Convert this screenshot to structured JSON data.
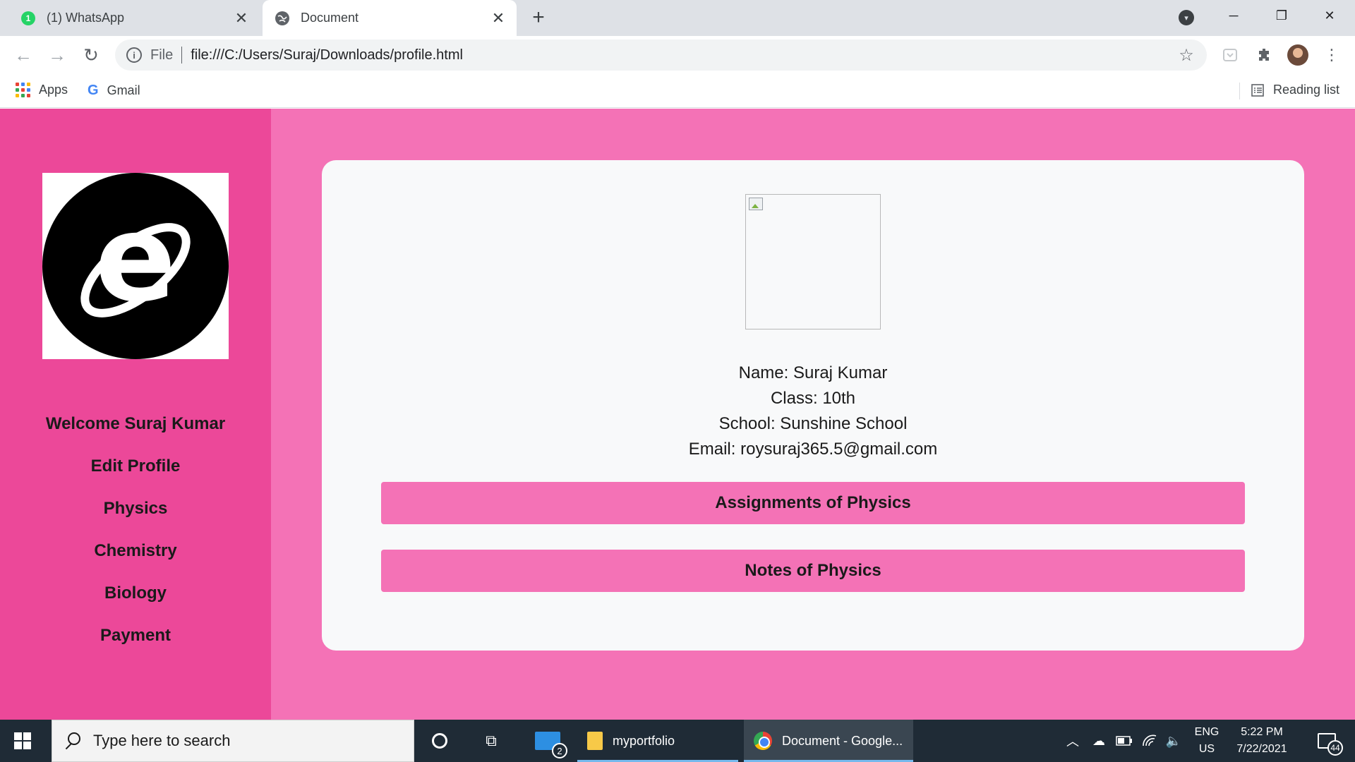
{
  "browser": {
    "tabs": [
      {
        "title": "(1) WhatsApp",
        "favicon": "whatsapp-icon",
        "badge": "1",
        "active": false
      },
      {
        "title": "Document",
        "favicon": "globe-icon",
        "active": true
      }
    ],
    "omnibox": {
      "scheme": "File",
      "url": "file:///C:/Users/Suraj/Downloads/profile.html"
    },
    "bookmarks": [
      {
        "label": "Apps",
        "icon": "apps-grid-icon"
      },
      {
        "label": "Gmail",
        "icon": "google-icon"
      }
    ],
    "reading_list": "Reading list"
  },
  "sidebar": {
    "logo": "internet-explorer-logo",
    "links": [
      {
        "label": "Welcome Suraj Kumar"
      },
      {
        "label": "Edit Profile"
      },
      {
        "label": "Physics"
      },
      {
        "label": "Chemistry"
      },
      {
        "label": "Biology"
      },
      {
        "label": "Payment"
      }
    ]
  },
  "profile": {
    "name_line": "Name: Suraj Kumar",
    "class_line": "Class: 10th",
    "school_line": "School: Sunshine School",
    "email_line": "Email: roysuraj365.5@gmail.com",
    "buttons": [
      {
        "label": "Assignments of Physics"
      },
      {
        "label": "Notes of Physics"
      }
    ]
  },
  "taskbar": {
    "search_placeholder": "Type here to search",
    "mail_badge": "2",
    "apps": [
      {
        "label": "myportfolio",
        "icon": "folder-icon"
      },
      {
        "label": "Document - Google...",
        "icon": "chrome-icon"
      }
    ],
    "language": {
      "lang": "ENG",
      "region": "US"
    },
    "time": "5:22 PM",
    "date": "7/22/2021",
    "notification_count": "44"
  },
  "colors": {
    "sidebar_bg": "#ec4899",
    "page_bg": "#f472b6",
    "card_bg": "#f8f9fa",
    "button_bg": "#f472b6"
  }
}
